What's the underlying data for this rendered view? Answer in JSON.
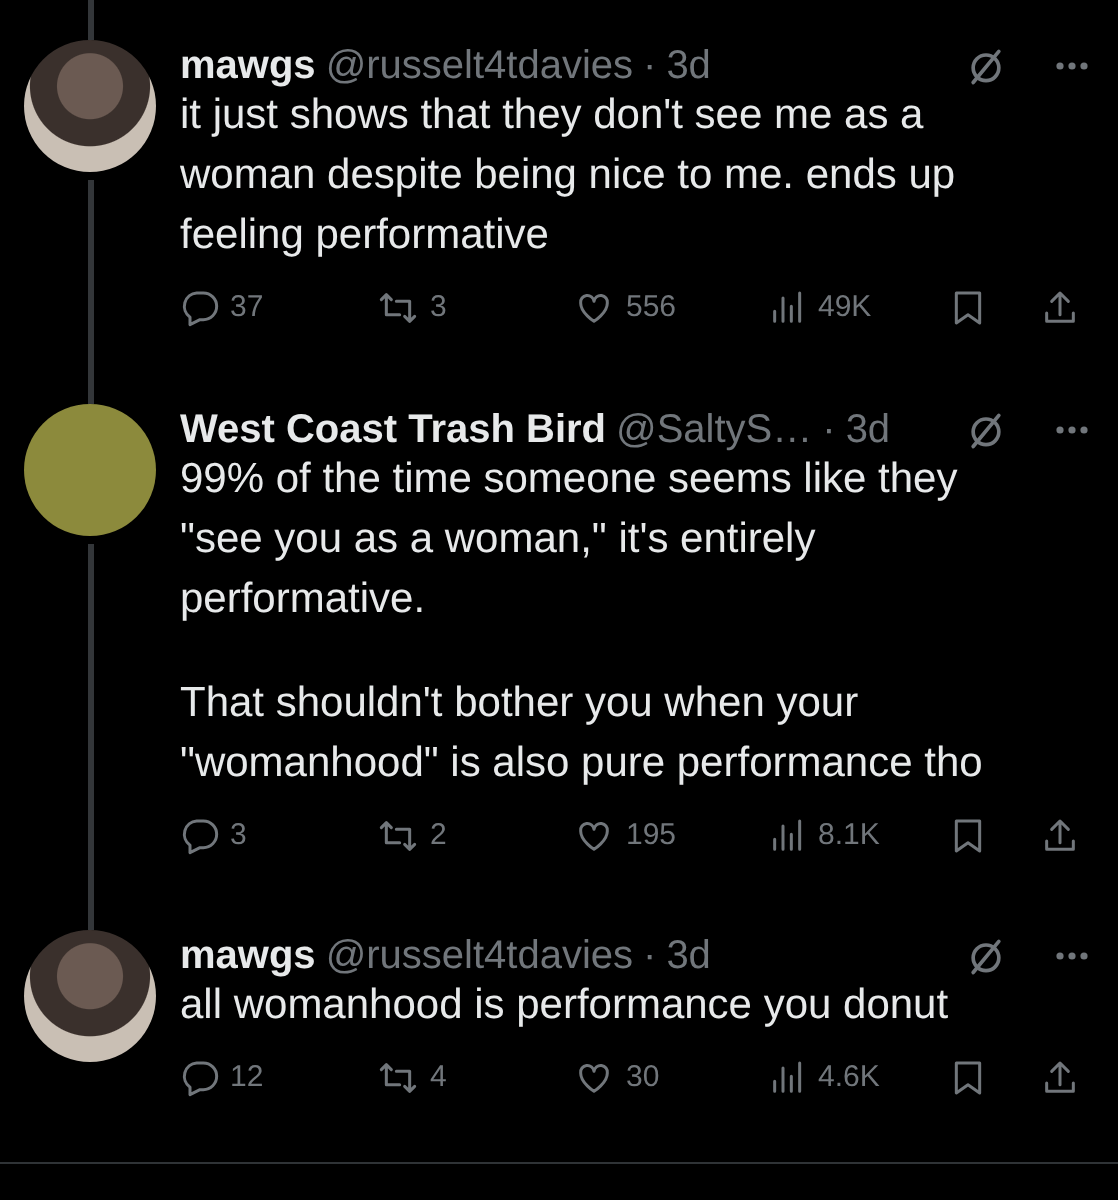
{
  "tweets": [
    {
      "name": "mawgs",
      "handle": "@russelt4tdavies",
      "dot": "·",
      "time": "3d",
      "kind": "photo",
      "thread_above": true,
      "thread_below": true,
      "paragraphs": [
        "it just shows that they don't see me as a woman despite being nice to me. ends up feeling performative"
      ],
      "replies": "37",
      "reposts": "3",
      "likes": "556",
      "views": "49K"
    },
    {
      "name": "West Coast Trash Bird",
      "handle": "@SaltyS…",
      "dot": "·",
      "time": "3d",
      "kind": "drawing",
      "thread_above": true,
      "thread_below": true,
      "paragraphs": [
        "99% of the time someone seems like they \"see you as a woman,\" it's entirely performative.",
        "That shouldn't bother you when your \"womanhood\" is also pure performance tho"
      ],
      "replies": "3",
      "reposts": "2",
      "likes": "195",
      "views": "8.1K"
    },
    {
      "name": "mawgs",
      "handle": "@russelt4tdavies",
      "dot": "·",
      "time": "3d",
      "kind": "photo",
      "thread_above": true,
      "thread_below": false,
      "paragraphs": [
        "all womanhood is performance you donut"
      ],
      "replies": "12",
      "reposts": "4",
      "likes": "30",
      "views": "4.6K"
    }
  ]
}
